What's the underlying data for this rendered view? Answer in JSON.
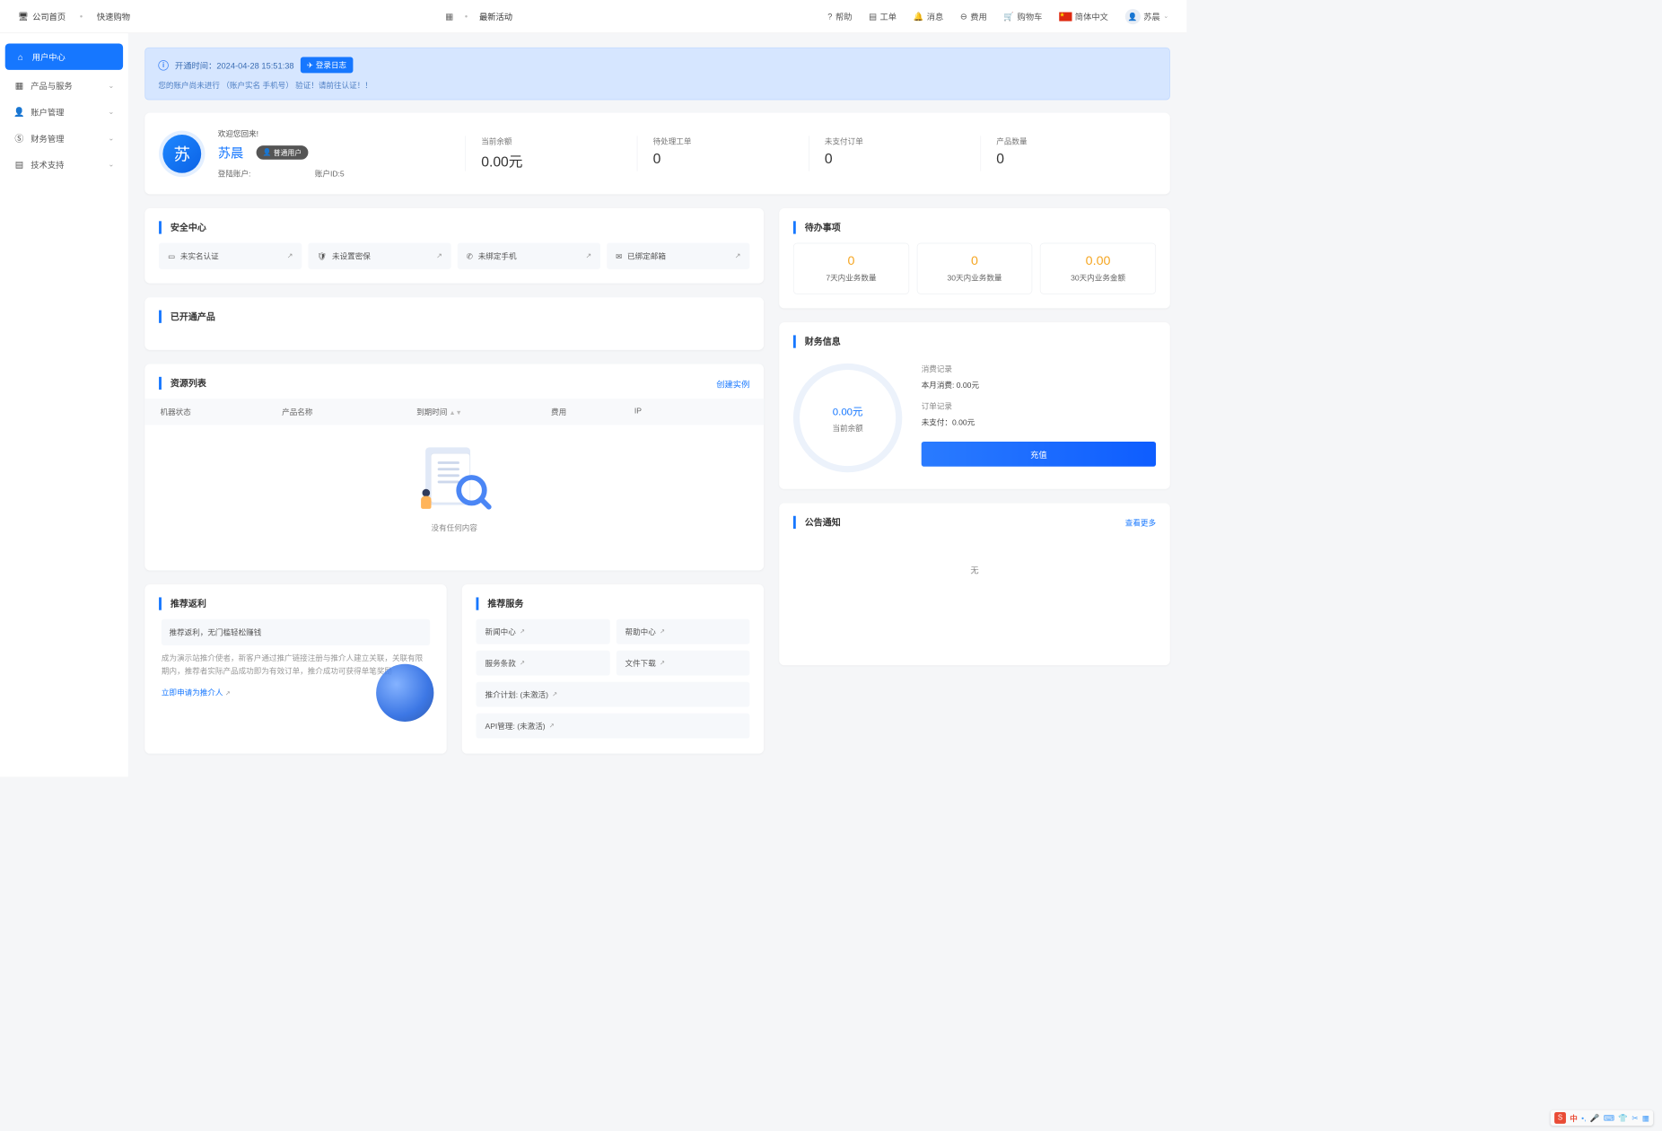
{
  "topbar": {
    "home": "公司首页",
    "shop": "快速购物",
    "latest": "最新活动",
    "help": "帮助",
    "tickets": "工单",
    "messages": "消息",
    "fees": "费用",
    "cart": "购物车",
    "lang": "简体中文",
    "user": "苏晨"
  },
  "sidebar": {
    "items": [
      {
        "label": "用户中心"
      },
      {
        "label": "产品与服务"
      },
      {
        "label": "账户管理"
      },
      {
        "label": "财务管理"
      },
      {
        "label": "技术支持"
      }
    ]
  },
  "alert": {
    "opened_prefix": "开通时间：",
    "opened_time": "2024-04-28 15:51:38",
    "login_log_btn": "登录日志",
    "row2": "您的账户尚未进行 （账户实名 手机号） 验证！请前往认证！！"
  },
  "user": {
    "avatar_char": "苏",
    "welcome": "欢迎您回来!",
    "name": "苏晨",
    "badge": "普通用户",
    "login_account_label": "登陆账户:",
    "login_account": "",
    "account_id_label": "账户ID:5"
  },
  "stats": [
    {
      "label": "当前余额",
      "value": "0.00元"
    },
    {
      "label": "待处理工单",
      "value": "0"
    },
    {
      "label": "未支付订单",
      "value": "0"
    },
    {
      "label": "产品数量",
      "value": "0"
    }
  ],
  "security": {
    "title": "安全中心",
    "items": [
      {
        "label": "未实名认证"
      },
      {
        "label": "未设置密保"
      },
      {
        "label": "未绑定手机"
      },
      {
        "label": "已绑定邮箱"
      }
    ]
  },
  "opened": {
    "title": "已开通产品"
  },
  "resources": {
    "title": "资源列表",
    "create": "创建实例",
    "cols": [
      "机器状态",
      "产品名称",
      "到期时间",
      "费用",
      "IP"
    ],
    "empty": "没有任何内容"
  },
  "todo": {
    "title": "待办事项",
    "items": [
      {
        "val": "0",
        "lbl": "7天内业务数量"
      },
      {
        "val": "0",
        "lbl": "30天内业务数量"
      },
      {
        "val": "0.00",
        "lbl": "30天内业务金额"
      }
    ]
  },
  "finance": {
    "title": "财务信息",
    "balance": "0.00元",
    "balance_label": "当前余额",
    "consume_label": "消费记录",
    "month_label": "本月消费: 0.00元",
    "order_label": "订单记录",
    "unpaid_label": "未支付：0.00元",
    "recharge": "充值"
  },
  "announce": {
    "title": "公告通知",
    "more": "查看更多",
    "none": "无"
  },
  "promo": {
    "title": "推荐返利",
    "subtitle": "推荐返利，无门槛轻松赚钱",
    "desc": "成为演示站推介使者，新客户通过推广链接注册与推介人建立关联，关联有限期内，推荐者实际产品成功即为有效订单，推介成功可获得单笔奖励",
    "apply": "立即申请为推介人"
  },
  "services": {
    "title": "推荐服务",
    "items": [
      {
        "label": "新闻中心"
      },
      {
        "label": "帮助中心"
      },
      {
        "label": "服务条款"
      },
      {
        "label": "文件下载"
      },
      {
        "label": "推介计划:  (未激活)",
        "full": true
      },
      {
        "label": "API管理:  (未激活)",
        "full": true
      }
    ]
  },
  "ime": {
    "zh": "中"
  }
}
